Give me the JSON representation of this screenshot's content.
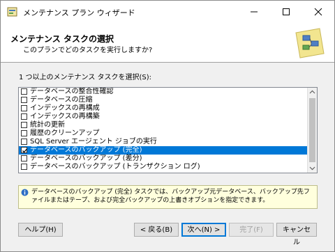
{
  "window": {
    "title": "メンテナンス プラン ウィザード"
  },
  "header": {
    "title": "メンテナンス タスクの選択",
    "subtitle": "このプランでどのタスクを実行しますか?"
  },
  "instruction": "1 つ以上のメンテナンス タスクを選択(S):",
  "tasks": [
    {
      "label": "データベースの整合性確認",
      "checked": false,
      "selected": false
    },
    {
      "label": "データベースの圧縮",
      "checked": false,
      "selected": false
    },
    {
      "label": "インデックスの再構成",
      "checked": false,
      "selected": false
    },
    {
      "label": "インデックスの再構築",
      "checked": false,
      "selected": false
    },
    {
      "label": "統計の更新",
      "checked": false,
      "selected": false
    },
    {
      "label": "履歴のクリーンアップ",
      "checked": false,
      "selected": false
    },
    {
      "label": "SQL Server エージェント ジョブの実行",
      "checked": false,
      "selected": false
    },
    {
      "label": "データベースのバックアップ (完全)",
      "checked": true,
      "selected": true
    },
    {
      "label": "データベースのバックアップ (差分)",
      "checked": false,
      "selected": false
    },
    {
      "label": "データベースのバックアップ (トランザクション ログ)",
      "checked": false,
      "selected": false
    }
  ],
  "description": "データベースのバックアップ (完全) タスクでは、バックアップ元データベース、バックアップ先ファイルまたはテープ、および完全バックアップの上書きオプションを指定できます。",
  "buttons": {
    "help": "ヘルプ(H)",
    "back": "< 戻る(B)",
    "next": "次へ(N) >",
    "finish": "完了(F)",
    "cancel": "キャンセル"
  },
  "colors": {
    "selection": "#0078d7",
    "description_bg": "#ffffdd"
  },
  "icons": [
    "wizard-app-icon",
    "minimize-icon",
    "maximize-icon",
    "close-icon",
    "info-icon",
    "scroll-up-icon",
    "scroll-down-icon"
  ]
}
